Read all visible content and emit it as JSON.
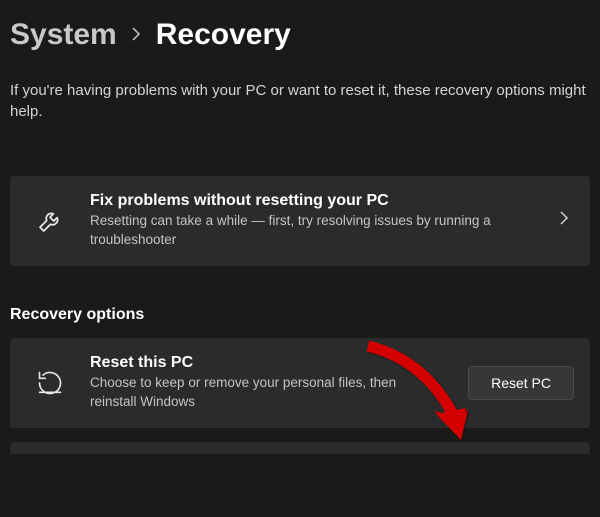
{
  "breadcrumb": {
    "parent": "System",
    "current": "Recovery"
  },
  "intro": "If you're having problems with your PC or want to reset it, these recovery options might help.",
  "fix_card": {
    "title": "Fix problems without resetting your PC",
    "desc": "Resetting can take a while — first, try resolving issues by running a troubleshooter"
  },
  "section_header": "Recovery options",
  "reset_card": {
    "title": "Reset this PC",
    "desc": "Choose to keep or remove your personal files, then reinstall Windows",
    "button": "Reset PC"
  }
}
